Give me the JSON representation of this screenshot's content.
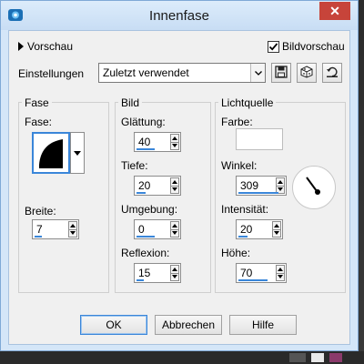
{
  "window": {
    "title": "Innenfase",
    "close_glyph": "✕"
  },
  "top": {
    "preview_label": "Vorschau",
    "bild_preview_label": "Bildvorschau",
    "bild_preview_checked": true,
    "settings_label": "Einstellungen",
    "settings_value": "Zuletzt verwendet",
    "icons": [
      "save-preset-icon",
      "randomize-icon",
      "reset-icon"
    ]
  },
  "fase": {
    "title": "Fase",
    "shape_label": "Fase:",
    "width_label": "Breite:",
    "width_value": "7"
  },
  "bild": {
    "title": "Bild",
    "fields": [
      {
        "label": "Glättung:",
        "value": "40"
      },
      {
        "label": "Tiefe:",
        "value": "20"
      },
      {
        "label": "Umgebung:",
        "value": "0"
      },
      {
        "label": "Reflexion:",
        "value": "15"
      }
    ]
  },
  "licht": {
    "title": "Lichtquelle",
    "color_label": "Farbe:",
    "color_value": "#ffffff",
    "angle_label": "Winkel:",
    "angle_value": "309",
    "intensity_label": "Intensität:",
    "intensity_value": "20",
    "height_label": "Höhe:",
    "height_value": "70"
  },
  "buttons": {
    "ok": "OK",
    "cancel": "Abbrechen",
    "help": "Hilfe"
  },
  "colors": {
    "accent": "#3a86d9",
    "close": "#c7443a",
    "title_bg": "#d4e6f8"
  }
}
